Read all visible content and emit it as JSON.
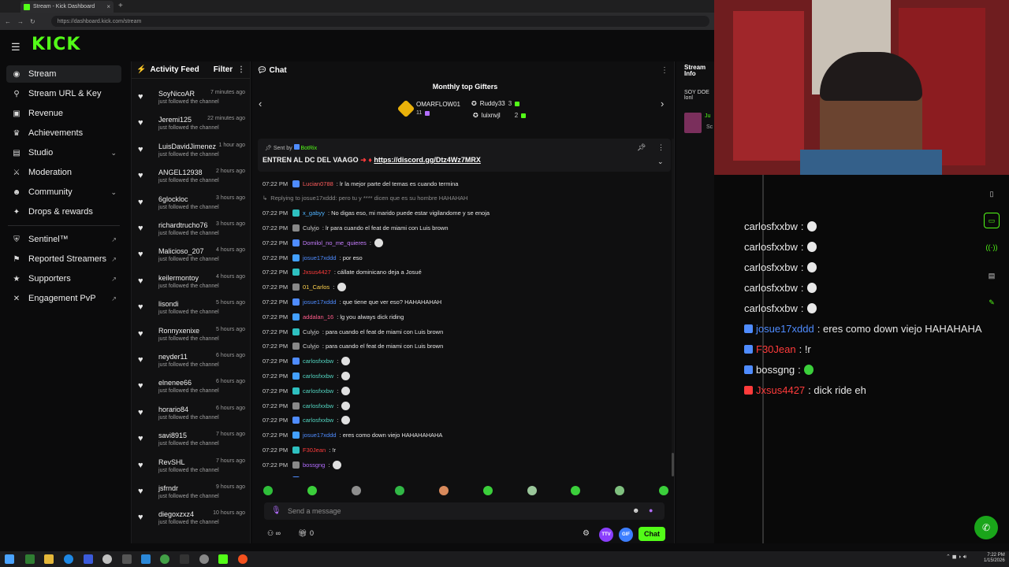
{
  "browser": {
    "tab_title": "Stream - Kick Dashboard",
    "url": "https://dashboard.kick.com/stream"
  },
  "brand": {
    "logo": "KICK",
    "accent": "#53fc18"
  },
  "sidebar": {
    "items": [
      {
        "label": "Stream",
        "icon": "broadcast-icon"
      },
      {
        "label": "Stream URL & Key",
        "icon": "key-icon"
      },
      {
        "label": "Revenue",
        "icon": "wallet-icon"
      },
      {
        "label": "Achievements",
        "icon": "trophy-icon"
      },
      {
        "label": "Studio",
        "icon": "studio-icon"
      },
      {
        "label": "Moderation",
        "icon": "sword-icon"
      },
      {
        "label": "Community",
        "icon": "people-icon"
      },
      {
        "label": "Drops & rewards",
        "icon": "gift-icon"
      },
      {
        "label": "Sentinel™",
        "icon": "shield-icon"
      },
      {
        "label": "Reported Streamers",
        "icon": "flag-icon"
      },
      {
        "label": "Supporters",
        "icon": "star-icon"
      },
      {
        "label": "Engagement PvP",
        "icon": "versus-icon"
      }
    ]
  },
  "activity": {
    "title": "Activity Feed",
    "filter_label": "Filter",
    "items": [
      {
        "user": "SoyNicoAR",
        "time": "7 minutes ago",
        "text": "just followed the channel"
      },
      {
        "user": "Jeremi125",
        "time": "22 minutes ago",
        "text": "just followed the channel"
      },
      {
        "user": "LuisDavidJimenez",
        "time": "1 hour ago",
        "text": "just followed the channel"
      },
      {
        "user": "ANGEL12938",
        "time": "2 hours ago",
        "text": "just followed the channel"
      },
      {
        "user": "6glockloc",
        "time": "3 hours ago",
        "text": "just followed the channel"
      },
      {
        "user": "richardtrucho76",
        "time": "3 hours ago",
        "text": "just followed the channel"
      },
      {
        "user": "Malicioso_207",
        "time": "4 hours ago",
        "text": "just followed the channel"
      },
      {
        "user": "keilermontoy",
        "time": "4 hours ago",
        "text": "just followed the channel"
      },
      {
        "user": "lisondi",
        "time": "5 hours ago",
        "text": "just followed the channel"
      },
      {
        "user": "Ronnyxenixe",
        "time": "5 hours ago",
        "text": "just followed the channel"
      },
      {
        "user": "neyder11",
        "time": "6 hours ago",
        "text": "just followed the channel"
      },
      {
        "user": "elnenee66",
        "time": "6 hours ago",
        "text": "just followed the channel"
      },
      {
        "user": "horario84",
        "time": "6 hours ago",
        "text": "just followed the channel"
      },
      {
        "user": "savi8915",
        "time": "7 hours ago",
        "text": "just followed the channel"
      },
      {
        "user": "RevSHL",
        "time": "7 hours ago",
        "text": "just followed the channel"
      },
      {
        "user": "jsfrndr",
        "time": "9 hours ago",
        "text": "just followed the channel"
      },
      {
        "user": "diegoxzxz4",
        "time": "10 hours ago",
        "text": "just followed the channel"
      }
    ]
  },
  "chat": {
    "title": "Chat",
    "gifters_title": "Monthly top Gifters",
    "gifters": [
      {
        "name": "OMARFLOW01",
        "count": "11"
      },
      {
        "name": "Ruddy33",
        "count": "3"
      },
      {
        "name": "luixnvjl",
        "count": "2"
      }
    ],
    "pinned": {
      "sent_by": "Sent by",
      "author": "BotRix",
      "text": "ENTREN AL DC DEL VAAGO",
      "link": "https://discord.gg/Dtz4Wz7MRX"
    },
    "messages": [
      {
        "time": "07:22 PM",
        "user": "Lucian0788",
        "color": "#ff5c5c",
        "text": ": lr la mejor parte del temas es cuando termina"
      },
      {
        "time": "",
        "user": "Replying to josue17xddd: pero tu y **** dicen que es su hombre HAHAHAH",
        "color": "#8c8c8c",
        "text": "",
        "reply": true
      },
      {
        "time": "07:22 PM",
        "user": "x_gabyy",
        "color": "#4fb3ff",
        "text": ": No digas eso, mi marido puede estar vigilandome y se enoja"
      },
      {
        "time": "07:22 PM",
        "user": "Culyjo",
        "color": "#cfcfcf",
        "text": ": lr para cuando el feat de miami con Luis brown"
      },
      {
        "time": "07:22 PM",
        "user": "Domilol_no_me_quieres",
        "color": "#c77dff",
        "text": ":"
      },
      {
        "time": "07:22 PM",
        "user": "josue17xddd",
        "color": "#4f8cff",
        "text": ": por eso"
      },
      {
        "time": "07:22 PM",
        "user": "Jxsus4427",
        "color": "#ff3b3b",
        "text": ": cállate dominicano deja a Josué"
      },
      {
        "time": "07:22 PM",
        "user": "01_Carlos",
        "color": "#ffd24d",
        "text": ":"
      },
      {
        "time": "07:22 PM",
        "user": "josue17xddd",
        "color": "#4f8cff",
        "text": ": que tiene que ver eso? HAHAHAHAH"
      },
      {
        "time": "07:22 PM",
        "user": "addalan_16",
        "color": "#ff5c8a",
        "text": ": lg you always dick riding"
      },
      {
        "time": "07:22 PM",
        "user": "Culyjo",
        "color": "#cfcfcf",
        "text": ": para cuando el feat de miami con Luis brown"
      },
      {
        "time": "07:22 PM",
        "user": "Culyjo",
        "color": "#cfcfcf",
        "text": ": para cuando el feat de miami con Luis brown"
      },
      {
        "time": "07:22 PM",
        "user": "carlosfxxbw",
        "color": "#53d6c2",
        "text": ":"
      },
      {
        "time": "07:22 PM",
        "user": "carlosfxxbw",
        "color": "#53d6c2",
        "text": ":"
      },
      {
        "time": "07:22 PM",
        "user": "carlosfxxbw",
        "color": "#53d6c2",
        "text": ":"
      },
      {
        "time": "07:22 PM",
        "user": "carlosfxxbw",
        "color": "#53d6c2",
        "text": ":"
      },
      {
        "time": "07:22 PM",
        "user": "carlosfxxbw",
        "color": "#53d6c2",
        "text": ":"
      },
      {
        "time": "07:22 PM",
        "user": "josue17xddd",
        "color": "#4f8cff",
        "text": ": eres como down viejo HAHAHAHAHA"
      },
      {
        "time": "07:22 PM",
        "user": "F30Jean",
        "color": "#ff3b3b",
        "text": ": !r"
      },
      {
        "time": "07:22 PM",
        "user": "bossgng",
        "color": "#b26dff",
        "text": ":"
      },
      {
        "time": "07:22 PM",
        "user": "Jxsus4427",
        "color": "#ff3b3b",
        "text": ": dick ride eh"
      }
    ],
    "input_placeholder": "Send a message",
    "viewers_label": "∞",
    "gift_count": "0",
    "chat_button": "Chat",
    "ttv_label": "TTV",
    "gif_label": "GIF"
  },
  "stream_info": {
    "title_1": "Stream",
    "title_2": "Info",
    "soy": "SOY DOE",
    "lon": "lonl",
    "ju": "Ju",
    "sc": "Sc"
  },
  "overlay_chat": [
    {
      "user": "carlosfxxbw",
      "color": "#e8e8e8",
      "text": ":"
    },
    {
      "user": "carlosfxxbw",
      "color": "#e8e8e8",
      "text": ":"
    },
    {
      "user": "carlosfxxbw",
      "color": "#e8e8e8",
      "text": ":"
    },
    {
      "user": "carlosfxxbw",
      "color": "#e8e8e8",
      "text": ":"
    },
    {
      "user": "carlosfxxbw",
      "color": "#e8e8e8",
      "text": ":"
    },
    {
      "user": "josue17xddd",
      "color": "#4f8cff",
      "text": ": eres como down viejo HAHAHAHA"
    },
    {
      "user": "F30Jean",
      "color": "#ff3b3b",
      "text": ": !r"
    },
    {
      "user": "bossgng",
      "color": "#e8e8e8",
      "text": ":"
    },
    {
      "user": "Jxsus4427",
      "color": "#ff3b3b",
      "text": ": dick ride eh"
    }
  ],
  "taskbar": {
    "clock_time": "7:22 PM",
    "clock_date": "1/15/2026"
  }
}
